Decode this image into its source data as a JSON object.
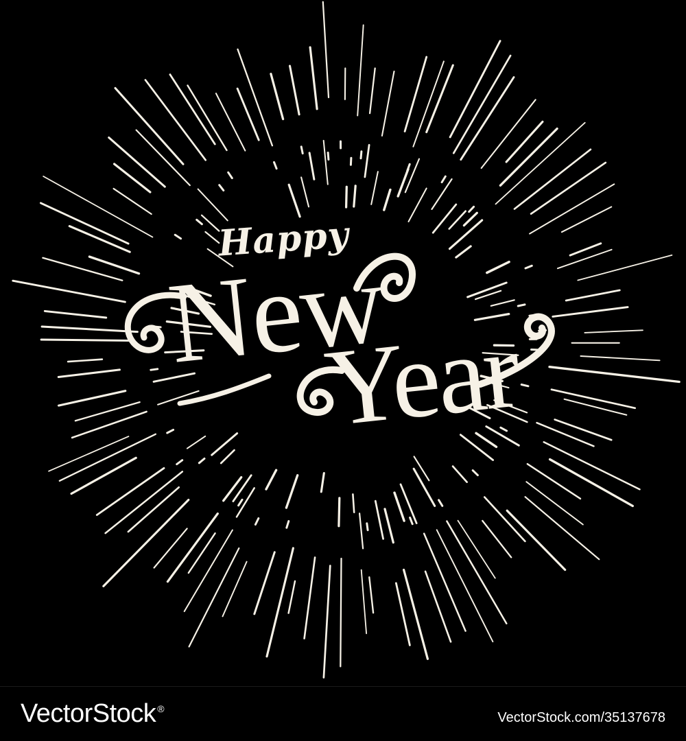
{
  "artwork": {
    "line1": "Happy",
    "line2": "New",
    "line3": "Year",
    "background_color": "#000000",
    "ink_color": "#f6f1e6"
  },
  "watermark": {
    "logo_text": "VectorStock",
    "logo_mark": "®",
    "url": "VectorStock.com/35137678"
  }
}
